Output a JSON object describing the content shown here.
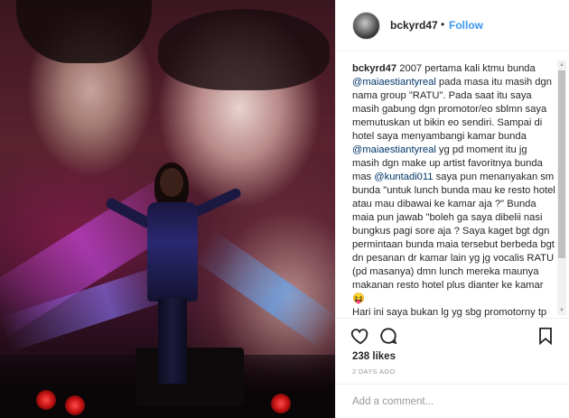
{
  "post": {
    "username": "bckyrd47",
    "separator": "•",
    "follow_label": "Follow"
  },
  "caption": {
    "username": "bckyrd47",
    "segments": [
      {
        "text": " 2007 pertama kali ktmu bunda ",
        "mention": false
      },
      {
        "text": "@maiaestiantyreal",
        "mention": true
      },
      {
        "text": " pada masa itu masih dgn nama group \"RATU\". Pada saat itu saya masih gabung dgn promotor/eo sblmn saya memutuskan ut bikin eo sendiri. Sampai di hotel saya menyambangi kamar bunda ",
        "mention": false
      },
      {
        "text": "@maiaestiantyreal",
        "mention": true
      },
      {
        "text": " yg pd moment itu jg masih dgn make up artist favoritnya bunda mas ",
        "mention": false
      },
      {
        "text": "@kuntadi011",
        "mention": true
      },
      {
        "text": " saya pun menanyakan sm bunda \"untuk lunch bunda mau ke resto hotel atau mau dibawai ke kamar aja ?\" Bunda maia pun jawab \"boleh ga saya dibelii nasi bungkus pagi sore aja ? Saya kaget bgt dgn permintaan bunda maia tersebut berbeda bgt dn pesanan dr kamar lain yg jg vocalis RATU (pd masanya) dmn lunch mereka maunya makanan resto hotel plus dianter ke kamar😝",
        "mention": false
      },
      {
        "text": "\nHari ini saya bukan lg yg sbg promotorny tp sbg penikmat musik dan konser. tidak",
        "mention": false
      }
    ]
  },
  "actions": {
    "like_icon": "heart-icon",
    "comment_icon": "comment-icon",
    "save_icon": "bookmark-icon"
  },
  "likes": "238 likes",
  "time": "2 DAYS AGO",
  "comment": {
    "placeholder": "Add a comment..."
  }
}
